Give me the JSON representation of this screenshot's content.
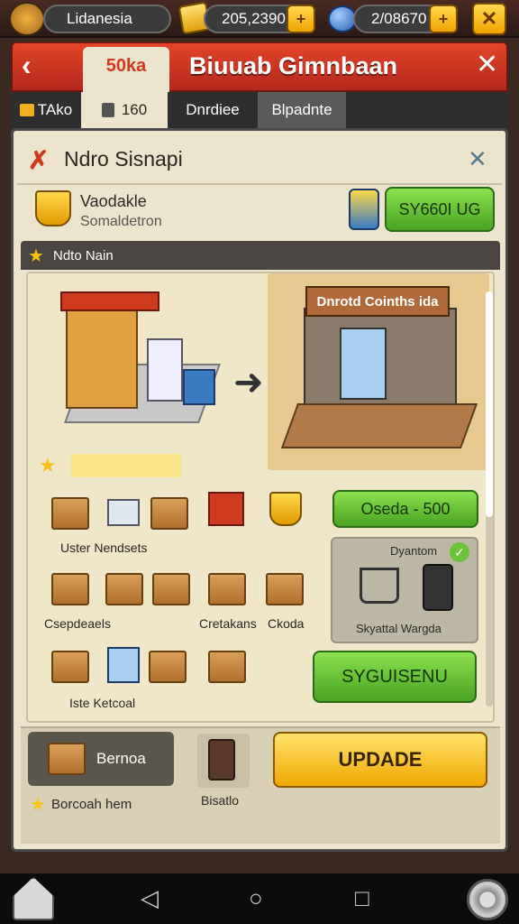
{
  "topbar": {
    "player_name": "Lidanesia",
    "gold_value": "205,2390",
    "gem_value": "2/08670"
  },
  "header": {
    "title": "Biuuab Gimnbaan"
  },
  "tabs": [
    {
      "label": "50ka"
    },
    {
      "label": "TAko"
    },
    {
      "label": "160"
    },
    {
      "label": "Dnrdiee"
    },
    {
      "label": "Blpadnte"
    }
  ],
  "dialog": {
    "title": "Ndro Sisnapi",
    "item_name": "Vaodakle",
    "item_sub": "Somaldetron",
    "price_button": "SY660I UG"
  },
  "section": {
    "label": "Ndto Nain"
  },
  "store_sign": "Dnrotd Coinths ida",
  "items": {
    "row1_label": "Uster Nendsets",
    "row2_label_left": "Csepdeaels",
    "row2_label_mid": "Cretakans",
    "row2_label_right": "Ckoda",
    "row3_label": "Iste Ketcoal"
  },
  "side": {
    "cost_button": "Oseda - 500",
    "panel_title": "Dyantom",
    "panel_caption": "Skyattal Wargda",
    "confirm_button": "SYGUISENU"
  },
  "bottom": {
    "renew_label": "Bernoa",
    "reward_label": "Borcoah hem",
    "tool_label": "Bisatlo",
    "update_button": "UPDADE"
  },
  "colors": {
    "header_red": "#d0381f",
    "green_button": "#5fbf2e",
    "update_yellow": "#f7c21a"
  }
}
